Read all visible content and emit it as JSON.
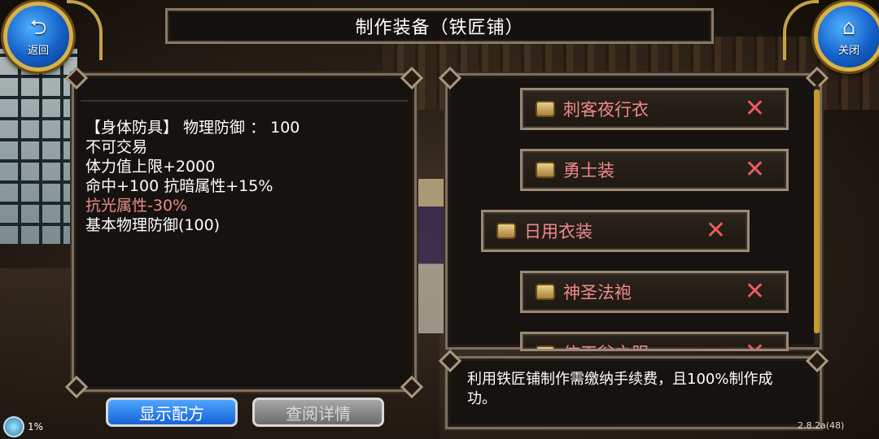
{
  "title": "制作装备（铁匠铺）",
  "nav": {
    "back_label": "返回",
    "close_label": "关闭"
  },
  "info": {
    "lines": [
      "【身体防具】 物理防御 ： 100",
      "不可交易",
      "体力值上限+2000",
      "命中+100 抗暗属性+15%",
      "抗光属性-30%",
      "基本物理防御(100)"
    ]
  },
  "items": [
    {
      "name": "刺客夜行衣",
      "selected": false
    },
    {
      "name": "勇士装",
      "selected": false
    },
    {
      "name": "日用衣装",
      "selected": true
    },
    {
      "name": "神圣法袍",
      "selected": false
    },
    {
      "name": "信天翁之服",
      "selected": false
    }
  ],
  "description": "利用铁匠铺制作需缴纳手续费，且100%制作成功。",
  "buttons": {
    "show_recipe": "显示配方",
    "view_detail": "查阅详情"
  },
  "status": {
    "percent": "1%",
    "version": "2.8.2a(48)"
  },
  "colors": {
    "warn_text": "#e98c8c",
    "item_name": "#f08a8a",
    "unavailable_x": "#ec5c5c",
    "scroll_thumb": "#c79a2c"
  }
}
